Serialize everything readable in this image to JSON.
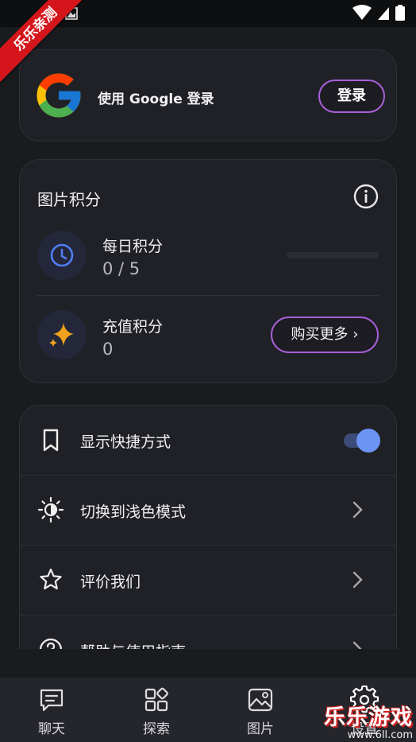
{
  "status_bar": {
    "icons": [
      "wifi-icon",
      "signal-icon",
      "battery-icon"
    ]
  },
  "ribbon": {
    "text": "乐乐亲测"
  },
  "login": {
    "text": "使用 Google 登录",
    "button_label": "登录",
    "logo": "google-logo"
  },
  "points": {
    "title": "图片积分",
    "daily": {
      "label": "每日积分",
      "value": "0 / 5",
      "progress": 0
    },
    "recharge": {
      "label": "充值积分",
      "value": "0",
      "button_label": "购买更多 ›"
    }
  },
  "settings": {
    "items": [
      {
        "label": "显示快捷方式",
        "icon": "bookmark-icon",
        "control": "toggle",
        "on": true
      },
      {
        "label": "切换到浅色模式",
        "icon": "sun-icon",
        "control": "chevron"
      },
      {
        "label": "评价我们",
        "icon": "star-icon",
        "control": "chevron"
      },
      {
        "label": "帮助与使用指南",
        "icon": "help-icon",
        "control": "chevron"
      }
    ]
  },
  "nav": {
    "items": [
      {
        "label": "聊天",
        "icon": "chat-icon"
      },
      {
        "label": "探索",
        "icon": "explore-icon"
      },
      {
        "label": "图片",
        "icon": "image-icon"
      },
      {
        "label": "设置",
        "icon": "gear-icon"
      }
    ]
  },
  "watermark": {
    "main": "乐乐游戏",
    "url": "www.6ll.com"
  },
  "colors": {
    "accent_border": "#a760d8",
    "toggle_on": "#6b94f5",
    "background": "#1a1b1f",
    "card": "#202126"
  }
}
